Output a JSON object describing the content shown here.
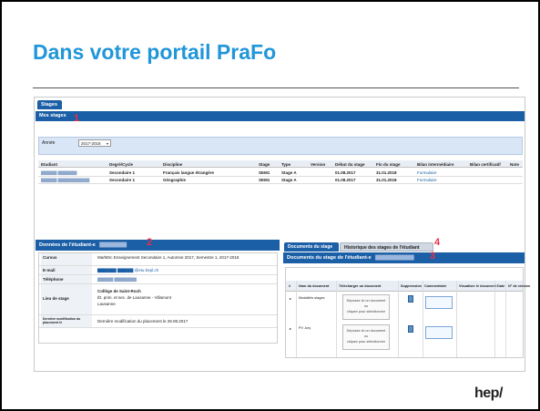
{
  "slide": {
    "title": "Dans votre portail PraFo",
    "logo": "hep/"
  },
  "colors": {
    "accent_title": "#2196d9",
    "header_bar": "#1b5fa6",
    "marker": "#e8304a"
  },
  "top_tab": "Stages",
  "section1": {
    "title": "Mes stages",
    "marker": "1",
    "year_label": "Année",
    "year_value": "2017-2018",
    "columns": [
      "Etudiant",
      "Degré/Cycle",
      "Discipline",
      "Stage",
      "Type",
      "Version",
      "Début du stage",
      "Fin du stage",
      "Bilan intermédiaire",
      "Bilan certificatif",
      "Note"
    ],
    "rows": [
      {
        "student": "▇▇▇▇▇ ▇▇▇▇▇▇",
        "degree": "Secondaire 1",
        "discipline": "Français langue étrangère",
        "stage": "SEM1",
        "type": "Stage A",
        "start": "01.08.2017",
        "end": "31.01.2018",
        "bilan": "Formulaire"
      },
      {
        "student": "▇▇▇▇▇ ▇▇▇▇▇▇▇▇▇▇",
        "degree": "Secondaire 1",
        "discipline": "Géographie",
        "stage": "SEM1",
        "type": "Stage A",
        "start": "01.08.2017",
        "end": "31.01.2018",
        "bilan": "Formulaire"
      }
    ]
  },
  "section2": {
    "title": "Données de l'étudiant-e",
    "title_blur": "▇▇▇▇▇▇▇",
    "marker": "2",
    "rows": [
      {
        "label": "Cursus",
        "value": "Ma/MSc Enseignement Secondaire 1, Automne 2017, Semestre 1, 2017-2018"
      },
      {
        "label": "E-mail",
        "value": "▇▇▇▇▇▇ ▇▇▇▇▇ @etu.hepl.ch"
      },
      {
        "label": "Téléphone",
        "value": "▇▇▇▇▇ ▇▇▇▇▇▇▇"
      },
      {
        "label": "Lieu de stage",
        "value": "Collège de Saint-Roch",
        "value2": "Ét. prim. et sec. de Lausanne - Villamont",
        "value3": "Lausanne"
      },
      {
        "label": "Dernière modification du placement le",
        "value": "Dernière modification du placement le 28.08.2017"
      }
    ]
  },
  "right_tabs": {
    "active": "Documents du stage",
    "inactive": "Historique des stages de l'étudiant",
    "marker": "4"
  },
  "section3": {
    "title": "Documents du stage de l'étudiant-e",
    "title_blur": "▇▇▇▇▇▇▇▇▇▇",
    "marker": "3",
    "columns": [
      "#",
      "Nom du document",
      "Télécharger un document",
      "Suppression",
      "Commentaire",
      "Visualiser le document",
      "Date",
      "N° de version"
    ],
    "rows": [
      {
        "name": "Modalités stages",
        "upload": [
          "Déposez ici un document",
          "ou",
          "cliquez pour sélectionner"
        ]
      },
      {
        "name": "PV Jury",
        "upload": [
          "Déposez ici un document",
          "ou",
          "cliquez pour sélectionner"
        ]
      }
    ]
  }
}
